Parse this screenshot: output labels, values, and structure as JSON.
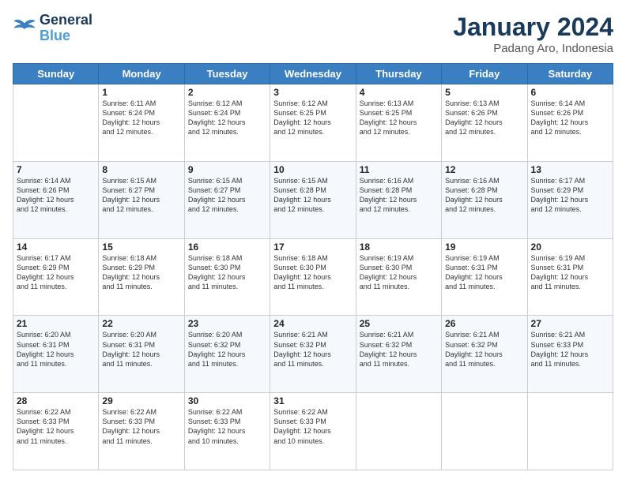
{
  "logo": {
    "line1": "General",
    "line2": "Blue"
  },
  "header": {
    "month": "January 2024",
    "location": "Padang Aro, Indonesia"
  },
  "days_of_week": [
    "Sunday",
    "Monday",
    "Tuesday",
    "Wednesday",
    "Thursday",
    "Friday",
    "Saturday"
  ],
  "weeks": [
    [
      {
        "day": "",
        "info": ""
      },
      {
        "day": "1",
        "info": "Sunrise: 6:11 AM\nSunset: 6:24 PM\nDaylight: 12 hours\nand 12 minutes."
      },
      {
        "day": "2",
        "info": "Sunrise: 6:12 AM\nSunset: 6:24 PM\nDaylight: 12 hours\nand 12 minutes."
      },
      {
        "day": "3",
        "info": "Sunrise: 6:12 AM\nSunset: 6:25 PM\nDaylight: 12 hours\nand 12 minutes."
      },
      {
        "day": "4",
        "info": "Sunrise: 6:13 AM\nSunset: 6:25 PM\nDaylight: 12 hours\nand 12 minutes."
      },
      {
        "day": "5",
        "info": "Sunrise: 6:13 AM\nSunset: 6:26 PM\nDaylight: 12 hours\nand 12 minutes."
      },
      {
        "day": "6",
        "info": "Sunrise: 6:14 AM\nSunset: 6:26 PM\nDaylight: 12 hours\nand 12 minutes."
      }
    ],
    [
      {
        "day": "7",
        "info": "Sunrise: 6:14 AM\nSunset: 6:26 PM\nDaylight: 12 hours\nand 12 minutes."
      },
      {
        "day": "8",
        "info": "Sunrise: 6:15 AM\nSunset: 6:27 PM\nDaylight: 12 hours\nand 12 minutes."
      },
      {
        "day": "9",
        "info": "Sunrise: 6:15 AM\nSunset: 6:27 PM\nDaylight: 12 hours\nand 12 minutes."
      },
      {
        "day": "10",
        "info": "Sunrise: 6:15 AM\nSunset: 6:28 PM\nDaylight: 12 hours\nand 12 minutes."
      },
      {
        "day": "11",
        "info": "Sunrise: 6:16 AM\nSunset: 6:28 PM\nDaylight: 12 hours\nand 12 minutes."
      },
      {
        "day": "12",
        "info": "Sunrise: 6:16 AM\nSunset: 6:28 PM\nDaylight: 12 hours\nand 12 minutes."
      },
      {
        "day": "13",
        "info": "Sunrise: 6:17 AM\nSunset: 6:29 PM\nDaylight: 12 hours\nand 12 minutes."
      }
    ],
    [
      {
        "day": "14",
        "info": "Sunrise: 6:17 AM\nSunset: 6:29 PM\nDaylight: 12 hours\nand 11 minutes."
      },
      {
        "day": "15",
        "info": "Sunrise: 6:18 AM\nSunset: 6:29 PM\nDaylight: 12 hours\nand 11 minutes."
      },
      {
        "day": "16",
        "info": "Sunrise: 6:18 AM\nSunset: 6:30 PM\nDaylight: 12 hours\nand 11 minutes."
      },
      {
        "day": "17",
        "info": "Sunrise: 6:18 AM\nSunset: 6:30 PM\nDaylight: 12 hours\nand 11 minutes."
      },
      {
        "day": "18",
        "info": "Sunrise: 6:19 AM\nSunset: 6:30 PM\nDaylight: 12 hours\nand 11 minutes."
      },
      {
        "day": "19",
        "info": "Sunrise: 6:19 AM\nSunset: 6:31 PM\nDaylight: 12 hours\nand 11 minutes."
      },
      {
        "day": "20",
        "info": "Sunrise: 6:19 AM\nSunset: 6:31 PM\nDaylight: 12 hours\nand 11 minutes."
      }
    ],
    [
      {
        "day": "21",
        "info": "Sunrise: 6:20 AM\nSunset: 6:31 PM\nDaylight: 12 hours\nand 11 minutes."
      },
      {
        "day": "22",
        "info": "Sunrise: 6:20 AM\nSunset: 6:31 PM\nDaylight: 12 hours\nand 11 minutes."
      },
      {
        "day": "23",
        "info": "Sunrise: 6:20 AM\nSunset: 6:32 PM\nDaylight: 12 hours\nand 11 minutes."
      },
      {
        "day": "24",
        "info": "Sunrise: 6:21 AM\nSunset: 6:32 PM\nDaylight: 12 hours\nand 11 minutes."
      },
      {
        "day": "25",
        "info": "Sunrise: 6:21 AM\nSunset: 6:32 PM\nDaylight: 12 hours\nand 11 minutes."
      },
      {
        "day": "26",
        "info": "Sunrise: 6:21 AM\nSunset: 6:32 PM\nDaylight: 12 hours\nand 11 minutes."
      },
      {
        "day": "27",
        "info": "Sunrise: 6:21 AM\nSunset: 6:33 PM\nDaylight: 12 hours\nand 11 minutes."
      }
    ],
    [
      {
        "day": "28",
        "info": "Sunrise: 6:22 AM\nSunset: 6:33 PM\nDaylight: 12 hours\nand 11 minutes."
      },
      {
        "day": "29",
        "info": "Sunrise: 6:22 AM\nSunset: 6:33 PM\nDaylight: 12 hours\nand 11 minutes."
      },
      {
        "day": "30",
        "info": "Sunrise: 6:22 AM\nSunset: 6:33 PM\nDaylight: 12 hours\nand 10 minutes."
      },
      {
        "day": "31",
        "info": "Sunrise: 6:22 AM\nSunset: 6:33 PM\nDaylight: 12 hours\nand 10 minutes."
      },
      {
        "day": "",
        "info": ""
      },
      {
        "day": "",
        "info": ""
      },
      {
        "day": "",
        "info": ""
      }
    ]
  ]
}
